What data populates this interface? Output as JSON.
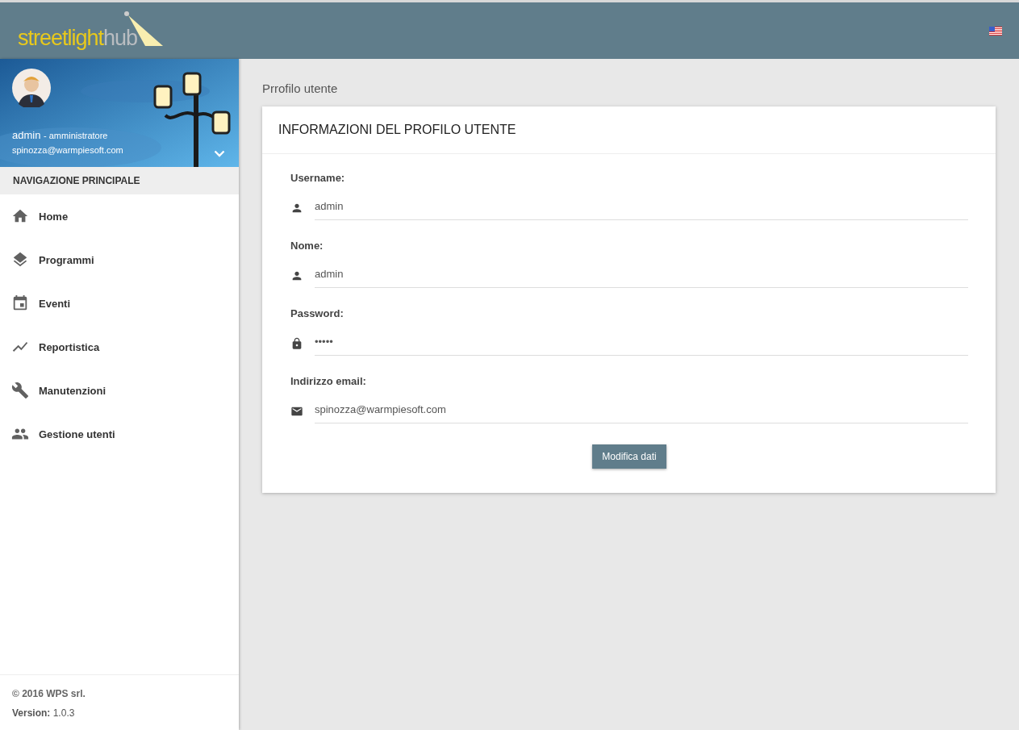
{
  "header": {
    "logo": {
      "primary": "streetlight",
      "secondary": "hub"
    }
  },
  "sidebar": {
    "user": {
      "name": "admin",
      "role": "- amministratore",
      "email": "spinozza@warmpiesoft.com"
    },
    "section_title": "NAVIGAZIONE PRINCIPALE",
    "items": [
      {
        "label": "Home"
      },
      {
        "label": "Programmi"
      },
      {
        "label": "Eventi"
      },
      {
        "label": "Reportistica"
      },
      {
        "label": "Manutenzioni"
      },
      {
        "label": "Gestione utenti"
      }
    ],
    "footer": {
      "copyright": "© 2016 WPS srl.",
      "version": "**Version:** 1.0.3"
    }
  },
  "page_title": "Prrofilo utente",
  "card": {
    "title": "INFORMAZIONI DEL PROFILO UTENTE",
    "fields": [
      {
        "label": "Username:",
        "value": "admin",
        "kind": "text"
      },
      {
        "label": "Nome:",
        "value": "admin",
        "kind": "text"
      },
      {
        "label": "Password:",
        "value": "•••••",
        "kind": "password"
      },
      {
        "label": "Indirizzo email:",
        "value": "spinozza@warmpiesoft.com",
        "kind": "email"
      }
    ],
    "button": "Modifica dati"
  }
}
